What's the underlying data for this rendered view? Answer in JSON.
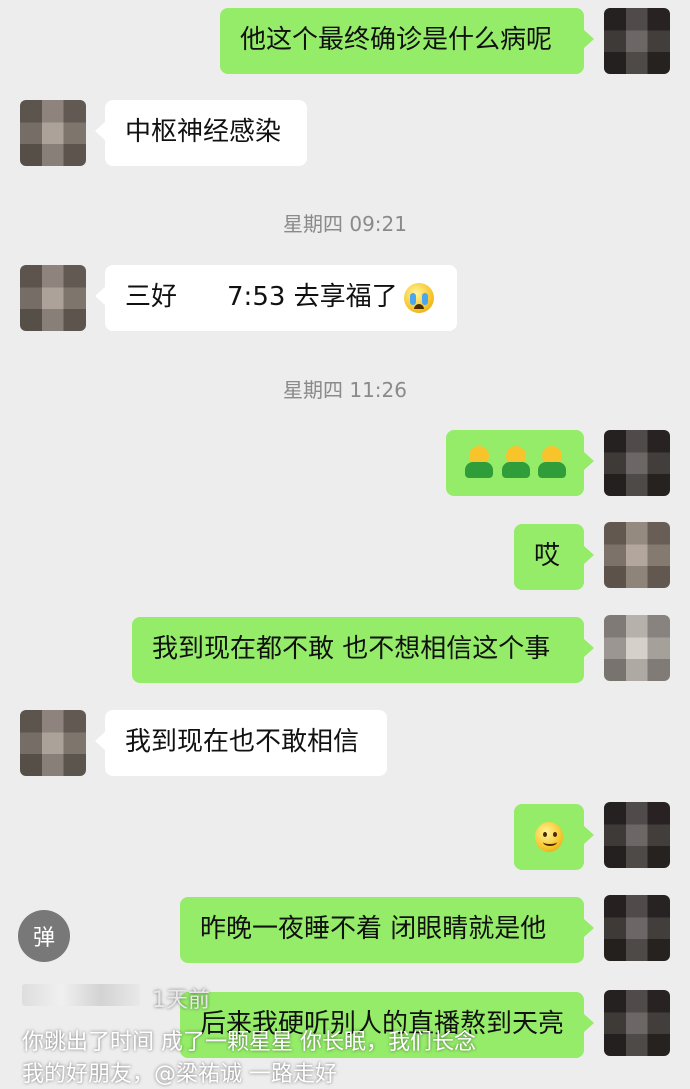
{
  "colors": {
    "sent_bubble": "#95ec69",
    "received_bubble": "#ffffff",
    "background": "#ededed"
  },
  "messages": {
    "m1_text": "他这个最终确诊是什么病呢",
    "m2_text": "中枢神经感染",
    "m3_prefix": "三好",
    "m3_suffix": "7:53 去享福了",
    "m3_emoji": "crying-face-icon",
    "m4_emoji": "smiley-people-icon",
    "m5_text": "哎",
    "m6_text": "我到现在都不敢 也不想相信这个事",
    "m7_text": "我到现在也不敢相信",
    "m8_emoji": "smiling-face-icon",
    "m9_text": "昨晚一夜睡不着 闭眼睛就是他",
    "m10_text": "后来我硬听别人的直播熬到天亮"
  },
  "timestamps": {
    "t1": "星期四 09:21",
    "t2": "星期四 11:26"
  },
  "overlay": {
    "danmaku_label": "弹",
    "time_ago": "1天前",
    "caption_line1": "你跳出了时间 成了一颗星星 你长眠，我们长念",
    "caption_line2": "我的好朋友，@梁祐诚 一路走好"
  }
}
